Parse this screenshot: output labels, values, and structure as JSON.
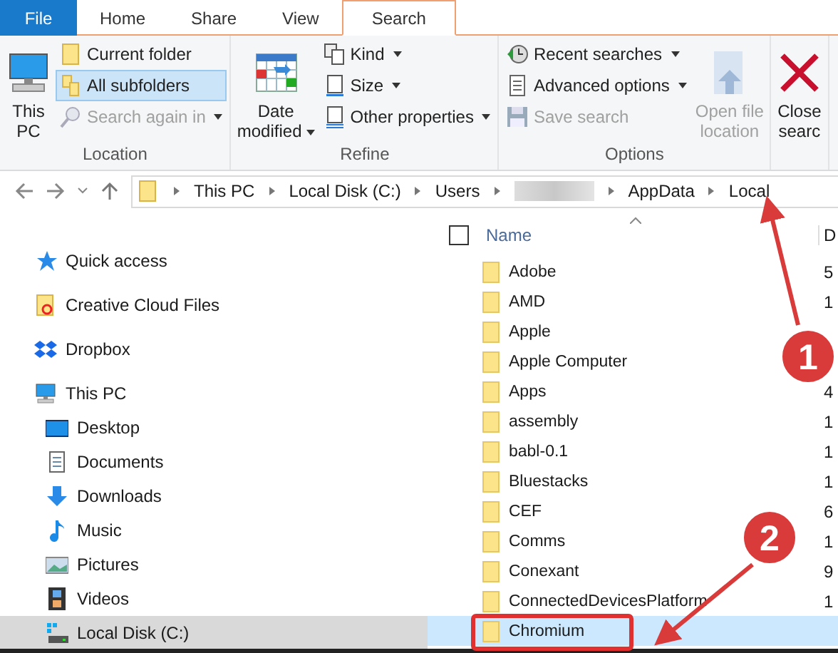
{
  "tabs": [
    {
      "label": "File",
      "kind": "file",
      "selected": false
    },
    {
      "label": "Home",
      "kind": "tab",
      "selected": false
    },
    {
      "label": "Share",
      "kind": "tab",
      "selected": false
    },
    {
      "label": "View",
      "kind": "tab",
      "selected": false
    },
    {
      "label": "Search",
      "kind": "tab",
      "selected": true
    }
  ],
  "ribbon": {
    "groups": [
      {
        "label": "Location",
        "items": [
          {
            "kind": "large",
            "lines": [
              "This",
              "PC"
            ],
            "disabled": false,
            "dropdown": false
          },
          {
            "kind": "small",
            "label": "Current folder",
            "selected": false,
            "disabled": false,
            "dropdown": false
          },
          {
            "kind": "small",
            "label": "All subfolders",
            "selected": true,
            "disabled": false,
            "dropdown": false
          },
          {
            "kind": "small",
            "label": "Search again in",
            "disabled": true,
            "dropdown": true
          }
        ]
      },
      {
        "label": "Refine",
        "items": [
          {
            "kind": "large",
            "lines": [
              "Date",
              "modified"
            ],
            "disabled": false,
            "dropdown": true
          },
          {
            "kind": "small",
            "label": "Kind",
            "disabled": false,
            "dropdown": true
          },
          {
            "kind": "small",
            "label": "Size",
            "disabled": false,
            "dropdown": true
          },
          {
            "kind": "small",
            "label": "Other properties",
            "disabled": false,
            "dropdown": true
          }
        ]
      },
      {
        "label": "Options",
        "items": [
          {
            "kind": "small",
            "label": "Recent searches",
            "disabled": false,
            "dropdown": true
          },
          {
            "kind": "small",
            "label": "Advanced options",
            "disabled": false,
            "dropdown": true
          },
          {
            "kind": "small",
            "label": "Save search",
            "disabled": true,
            "dropdown": false
          },
          {
            "kind": "large",
            "lines": [
              "Open file",
              "location"
            ],
            "disabled": true,
            "dropdown": false
          }
        ]
      },
      {
        "items": [
          {
            "kind": "large",
            "lines": [
              "Close",
              "searc"
            ],
            "disabled": false,
            "dropdown": false
          }
        ]
      }
    ]
  },
  "address_bar": {
    "crumbs": [
      {
        "kind": "text",
        "label": "This PC"
      },
      {
        "kind": "text",
        "label": "Local Disk (C:)"
      },
      {
        "kind": "text",
        "label": "Users"
      },
      {
        "kind": "blurred"
      },
      {
        "kind": "text",
        "label": "AppData"
      },
      {
        "kind": "text",
        "label": "Local"
      }
    ]
  },
  "sidebar": {
    "items": [
      {
        "label": "Quick access",
        "selected": false
      },
      {
        "label": "Creative Cloud Files",
        "selected": false
      },
      {
        "label": "Dropbox",
        "selected": false
      },
      {
        "label": "This PC",
        "selected": false,
        "children": [
          {
            "label": "Desktop",
            "selected": false
          },
          {
            "label": "Documents",
            "selected": false
          },
          {
            "label": "Downloads",
            "selected": false
          },
          {
            "label": "Music",
            "selected": false
          },
          {
            "label": "Pictures",
            "selected": false
          },
          {
            "label": "Videos",
            "selected": false
          },
          {
            "label": "Local Disk (C:)",
            "selected": true
          }
        ]
      }
    ]
  },
  "file_list": {
    "checked": false,
    "columns": [
      "Name",
      "D"
    ],
    "rows": [
      {
        "name": "Adobe",
        "column_2": "5",
        "selected": false
      },
      {
        "name": "AMD",
        "column_2": "1",
        "selected": false
      },
      {
        "name": "Apple",
        "selected": false
      },
      {
        "name": "Apple Computer",
        "selected": false
      },
      {
        "name": "Apps",
        "column_2": "4",
        "selected": false
      },
      {
        "name": "assembly",
        "column_2": "1",
        "selected": false
      },
      {
        "name": "babl-0.1",
        "column_2": "1",
        "selected": false
      },
      {
        "name": "Bluestacks",
        "column_2": "1",
        "selected": false
      },
      {
        "name": "CEF",
        "column_2": "6",
        "selected": false
      },
      {
        "name": "Comms",
        "column_2": "1",
        "selected": false
      },
      {
        "name": "Conexant",
        "column_2": "9",
        "selected": false
      },
      {
        "name": "ConnectedDevicesPlatform",
        "column_2": "1",
        "selected": false
      },
      {
        "name": "Chromium",
        "selected": true
      }
    ]
  },
  "annotations": [
    {
      "label": "1"
    },
    {
      "label": "2"
    }
  ]
}
